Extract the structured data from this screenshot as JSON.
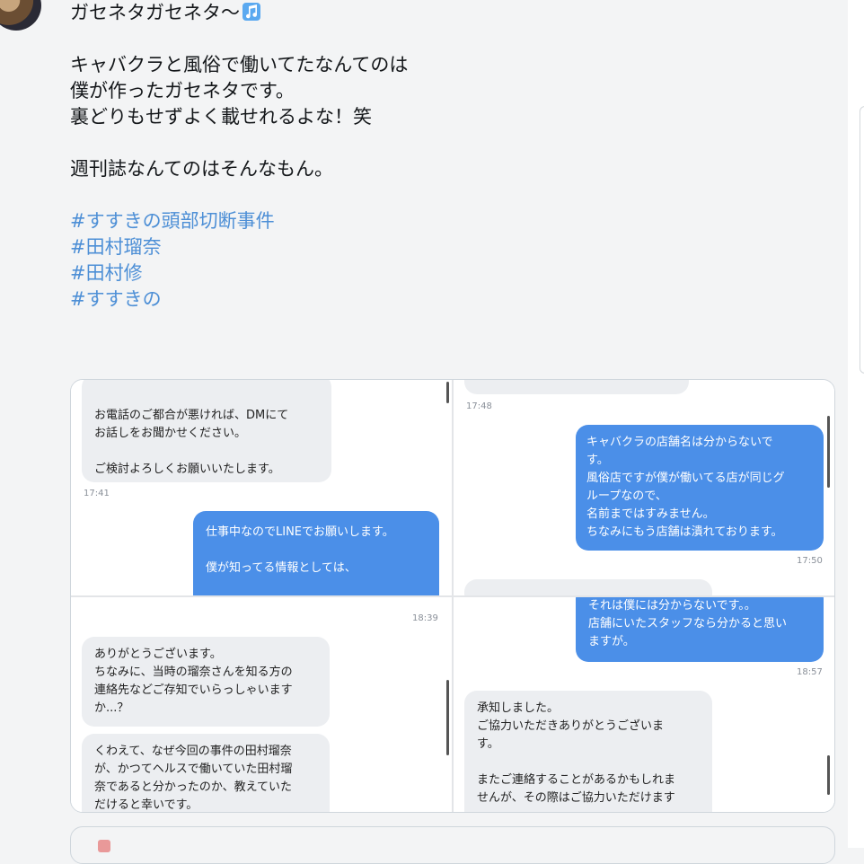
{
  "tweet": {
    "lines": [
      "ガセネタガセネタ〜",
      "",
      "キャバクラと風俗で働いてたなんてのは",
      "僕が作ったガセネタです。",
      "裏どりもせずよく載せれるよな！笑",
      "",
      "週刊誌なんてのはそんなもん。",
      ""
    ],
    "hashtags": [
      "#すすきの頭部切断事件",
      "#田村瑠奈",
      "#田村修",
      "#すすきの"
    ],
    "note_icon": "music-note-icon"
  },
  "media": {
    "p1": {
      "in_lines": [
        "お電話のご都合が悪ければ、DMにて",
        "お話しをお聞かせください。",
        "",
        "ご検討よろしくお願いいたします。"
      ],
      "in_time": "17:41",
      "out_lines": [
        "仕事中なのでLINEでお願いします。",
        "",
        "僕が知ってる情報としては、"
      ]
    },
    "p2": {
      "top_time": "17:48",
      "out_lines": [
        "キャバクラの店舗名は分からないで",
        "す。",
        "風俗店ですが僕が働いてる店が同じグ",
        "ループなので、",
        "名前まではすみません。",
        "ちなみにもう店舗は潰れております。"
      ],
      "out_time": "17:50"
    },
    "p3": {
      "top_time": "18:39",
      "in1_lines": [
        "ありがとうございます。",
        "ちなみに、当時の瑠奈さんを知る方の",
        "連絡先などご存知でいらっしゃいます",
        "か...？"
      ],
      "in2_lines": [
        "くわえて、なぜ今回の事件の田村瑠奈",
        "が、かつてヘルスで働いていた田村瑠",
        "奈であると分かったのか、教えていた",
        "だけると幸いです。"
      ]
    },
    "p4": {
      "out_lines": [
        "それは僕には分からないです。。",
        "店舗にいたスタッフなら分かると思い",
        "ますが。"
      ],
      "out_time": "18:57",
      "in_lines": [
        "承知しました。",
        "ご協力いただきありがとうございま",
        "す。",
        "",
        "またご連絡することがあるかもしれま",
        "せんが、その際はご協力いただけます"
      ]
    }
  },
  "colors": {
    "hashtag": "#4d8fd6",
    "bubble_out": "#4b8fe8",
    "bubble_in": "#eceef1",
    "background": "#f3f4f5"
  }
}
